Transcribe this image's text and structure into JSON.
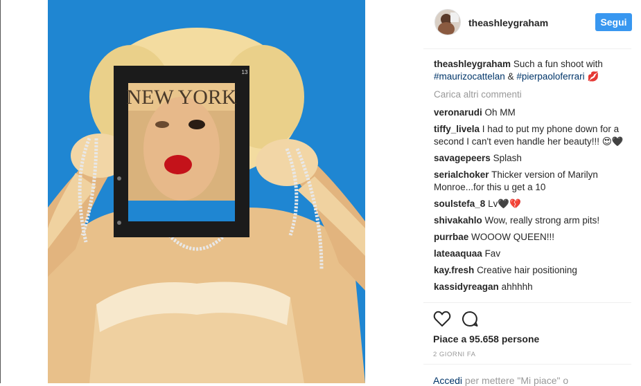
{
  "post": {
    "username": "theashleygraham",
    "follow_label": "Segui",
    "photo": {
      "magazine_title": "NEW YORK",
      "page_number": "13"
    },
    "caption": {
      "username": "theashleygraham",
      "text": "Such a fun shoot with",
      "tag1": "#maurizocattelan",
      "amp": "&",
      "tag2": "#pierpaoloferrari",
      "emoji": "💋"
    },
    "load_more": "Carica altri commenti",
    "comments": [
      {
        "user": "veronarudi",
        "text": "Oh MM"
      },
      {
        "user": "tiffy_livela",
        "text": "I had to put my phone down for a second I can't even handle her beauty!!! 😍🖤"
      },
      {
        "user": "savagepeers",
        "text": "Splash"
      },
      {
        "user": "serialchoker",
        "text": "Thicker version of Marilyn Monroe...for this u get a 10"
      },
      {
        "user": "soulstefa_8",
        "text": "Lv🖤💔"
      },
      {
        "user": "shivakahlo",
        "text": "Wow, really strong arm pits!"
      },
      {
        "user": "purrbae",
        "text": "WOOOW QUEEN!!!"
      },
      {
        "user": "lateaaquaa",
        "text": "Fav"
      },
      {
        "user": "kay.fresh",
        "text": "Creative hair positioning"
      },
      {
        "user": "kassidyreagan",
        "text": "ahhhhh"
      }
    ],
    "likes": "Piace a 95.658 persone",
    "date": "2 GIORNI FA",
    "login_link": "Accedi",
    "login_text": "per mettere \"Mi piace\" o",
    "icons": {
      "like": "heart-icon",
      "comment": "comment-bubble-icon"
    }
  }
}
